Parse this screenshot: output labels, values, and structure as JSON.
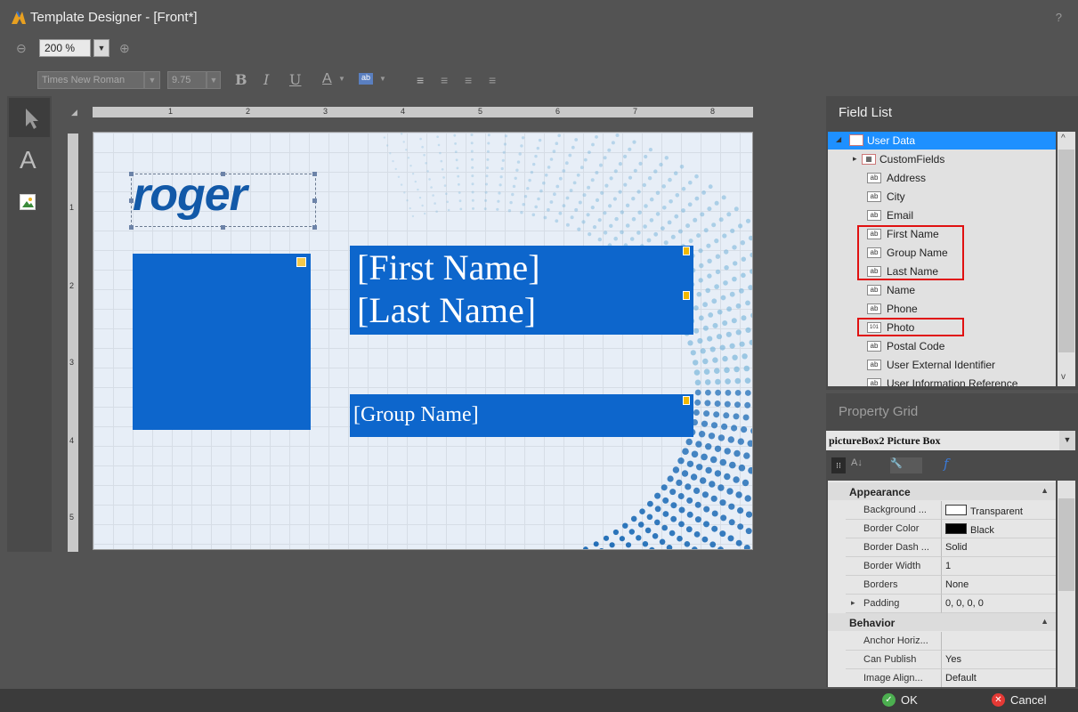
{
  "window": {
    "title": "Template Designer - [Front*]",
    "help": "?"
  },
  "zoom": {
    "value": "200 %"
  },
  "format": {
    "font": "Times New Roman",
    "size": "9.75",
    "bold": "B",
    "italic": "I",
    "underline": "U",
    "font_color": "A",
    "back_color": "ab"
  },
  "ruler": {
    "h": [
      "1",
      "2",
      "3",
      "4",
      "5",
      "6",
      "7",
      "8"
    ],
    "v": [
      "1",
      "2",
      "3",
      "4",
      "5"
    ]
  },
  "card": {
    "logo": "roger",
    "first_name": "[First Name]",
    "last_name": "[Last Name]",
    "group_name": "[Group Name]"
  },
  "field_list": {
    "title": "Field List",
    "root": "User Data",
    "items": [
      {
        "label": "CustomFields",
        "icon": "table-icon"
      },
      {
        "label": "Address",
        "icon": "ab"
      },
      {
        "label": "City",
        "icon": "ab"
      },
      {
        "label": "Email",
        "icon": "ab"
      },
      {
        "label": "First Name",
        "icon": "ab"
      },
      {
        "label": "Group Name",
        "icon": "ab"
      },
      {
        "label": "Last Name",
        "icon": "ab"
      },
      {
        "label": "Name",
        "icon": "ab"
      },
      {
        "label": "Phone",
        "icon": "ab"
      },
      {
        "label": "Photo",
        "icon": "101"
      },
      {
        "label": "Postal Code",
        "icon": "ab"
      },
      {
        "label": "User External Identifier",
        "icon": "ab"
      },
      {
        "label": "User Information Reference",
        "icon": "ab"
      }
    ]
  },
  "property_grid": {
    "title": "Property Grid",
    "selected": "pictureBox2  Picture Box",
    "categories": [
      {
        "name": "Appearance",
        "rows": [
          {
            "name": "Background ...",
            "value": "Transparent"
          },
          {
            "name": "Border Color",
            "value": "Black"
          },
          {
            "name": "Border Dash ...",
            "value": "Solid"
          },
          {
            "name": "Border Width",
            "value": "1"
          },
          {
            "name": "Borders",
            "value": "None"
          },
          {
            "name": "Padding",
            "value": "0, 0, 0, 0"
          }
        ]
      },
      {
        "name": "Behavior",
        "rows": [
          {
            "name": "Anchor Horiz...",
            "value": ""
          },
          {
            "name": "Can Publish",
            "value": "Yes"
          },
          {
            "name": "Image Align...",
            "value": "Default"
          }
        ]
      }
    ]
  },
  "buttons": {
    "ok": "OK",
    "cancel": "Cancel"
  },
  "colors": {
    "accent": "#0d66cc",
    "highlight": "#e01010",
    "selected_row": "#1e90ff"
  }
}
